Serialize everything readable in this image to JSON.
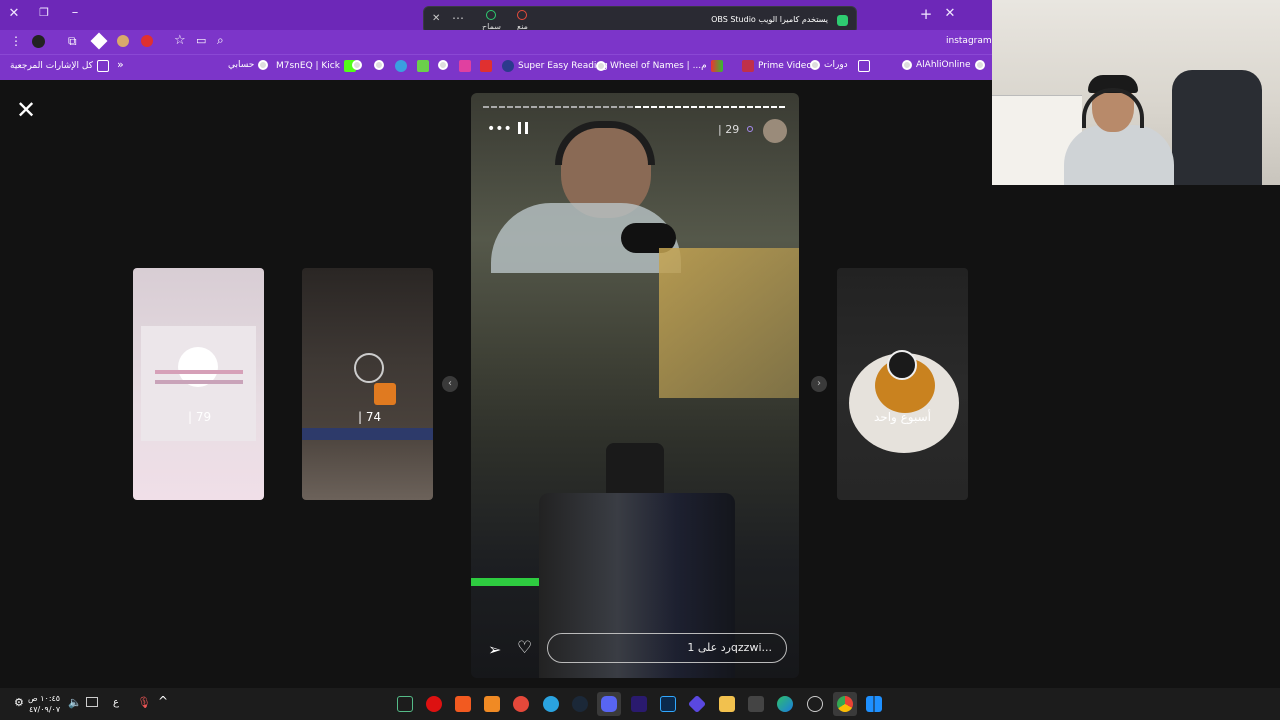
{
  "browser": {
    "obs_notice": "OBS Studio يستخدم كاميرا الويب",
    "obs_allow": "سماح",
    "obs_block": "منع",
    "address": "instagram.c"
  },
  "bookmarks": {
    "all_label": "كل الإشارات المرجعية",
    "items": [
      "حسابي",
      "M7snEQ | Kick",
      "Super Easy Reading",
      "Wheel of Names | ...م",
      "Prime Video",
      "دورات",
      "AlAhliOnline"
    ]
  },
  "story": {
    "time_ago": "29",
    "reply_placeholder": "رد على 1qzzwi..."
  },
  "side_stories": {
    "first_count": "79",
    "second_count": "74",
    "right_caption": "أسبوع واحد"
  },
  "taskbar": {
    "time": "١٠:٤٥ ص",
    "date": "٤٧/٠٩/٠٧",
    "lang": "ع"
  },
  "colors": {
    "chrome_accent": "#7c35c9",
    "background": "#121212"
  }
}
